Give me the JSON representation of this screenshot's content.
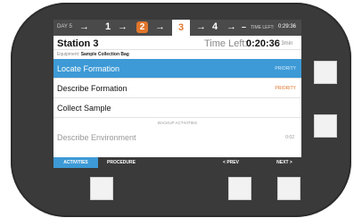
{
  "stepbar": {
    "day": "DAY 5",
    "arrow": "→",
    "steps": [
      "1",
      "2",
      "3",
      "4",
      "–"
    ],
    "time_left_label": "TIME LEFT:",
    "time_left_value": "0:29:36"
  },
  "header": {
    "station": "Station 3",
    "time_left_label": "Time Left:",
    "time_left_value": "0:20:36",
    "time_left_total": "/ 3min"
  },
  "equipment": {
    "label": "Equipment:",
    "value": "Sample Collection Bag"
  },
  "activities": [
    {
      "label": "Locate Formation",
      "tag": "PRIORITY"
    },
    {
      "label": "Describe Formation",
      "tag": "PRIORITY"
    },
    {
      "label": "Collect Sample",
      "tag": ""
    }
  ],
  "backup": {
    "divider": "BACKUP ACTIVITIES",
    "label": "Describe Environment",
    "duration": "0:02"
  },
  "bottombar": {
    "activities": "ACTIVITIES",
    "procedure": "PROCEDURE",
    "prev": "< PREV",
    "next": "NEXT >"
  },
  "colors": {
    "accent_blue": "#3d9ad6",
    "accent_orange": "#e0762b",
    "bezel": "#3a3a3a"
  }
}
